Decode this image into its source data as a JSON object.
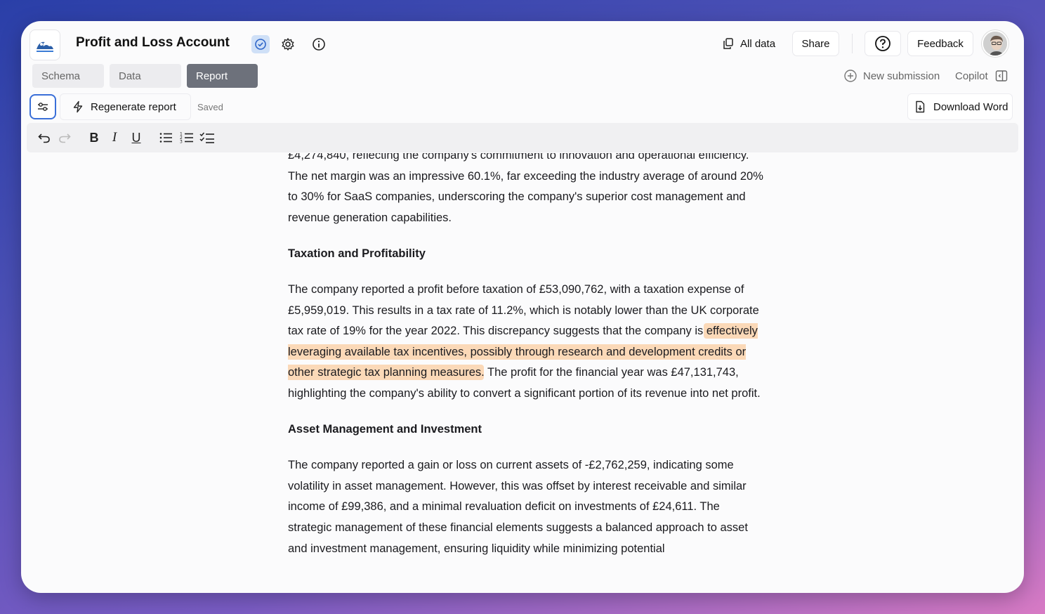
{
  "app": {
    "title": "Profit and Loss Account",
    "logo_icon": "wave-logo-icon"
  },
  "header": {
    "all_data_label": "All data",
    "share_label": "Share",
    "feedback_label": "Feedback"
  },
  "tabs": [
    {
      "label": "Schema",
      "active": false
    },
    {
      "label": "Data",
      "active": false
    },
    {
      "label": "Report",
      "active": true
    }
  ],
  "right_nav": {
    "new_submission_label": "New submission",
    "copilot_label": "Copilot"
  },
  "actions": {
    "regenerate_label": "Regenerate report",
    "status": "Saved",
    "download_label": "Download Word"
  },
  "document": {
    "para1": "£4,274,840, reflecting the company's commitment to innovation and operational efficiency. The net margin was an impressive 60.1%, far exceeding the industry average of around 20% to 30% for SaaS companies, underscoring the company's superior cost management and revenue generation capabilities.",
    "heading2": "Taxation and Profitability",
    "para2_before": "The company reported a profit before taxation of £53,090,762, with a taxation expense of £5,959,019. This results in a tax rate of 11.2%, which is notably lower than the UK corporate tax rate of 19% for the year 2022. This discrepancy suggests that the company is ",
    "para2_highlight": "effectively leveraging available tax incentives, possibly through research and development credits or other strategic tax planning measures",
    "para2_after": ". The profit for the financial year was £47,131,743, highlighting the company's ability to convert a significant portion of its revenue into net profit.",
    "heading3": "Asset Management and Investment",
    "para3": "The company reported a gain or loss on current assets of -£2,762,259, indicating some volatility in asset management. However, this was offset by interest receivable and similar income of £99,386, and a minimal revaluation deficit on investments of £24,611. The strategic management of these financial elements suggests a balanced approach to asset and investment management, ensuring liquidity while minimizing potential"
  },
  "colors": {
    "active_tab": "#6d717b",
    "highlight": "#fbd9b8",
    "accent": "#3a6fd8"
  }
}
